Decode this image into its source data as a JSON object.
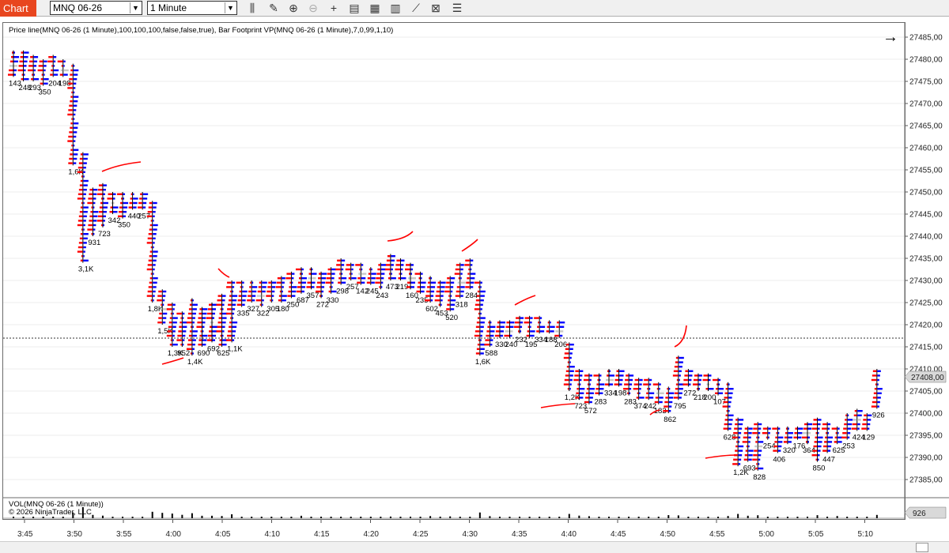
{
  "toolbar": {
    "tab_label": "Chart",
    "instrument": "MNQ 06-26",
    "interval": "1 Minute",
    "icons": [
      "bar-type-icon",
      "drawing-tool-icon",
      "zoom-in-icon",
      "zoom-out-icon",
      "crosshair-icon",
      "data-box-icon",
      "chart-trader-icon",
      "chart-style-icon",
      "indicators-icon",
      "strategies-icon",
      "properties-icon"
    ]
  },
  "chart": {
    "indicator_label": "Price line(MNQ 06-26 (1 Minute),100,100,100,false,false,true), Bar Footprint VP(MNQ 06-26 (1 Minute),7,0,99,1,10)",
    "vol_label": "VOL(MNQ 06-26 (1 Minute))",
    "copyright": "© 2026 NinjaTrader, LLC",
    "current_price": "27408,00",
    "current_volume": "926",
    "price_axis": {
      "ticks": [
        "27485,00",
        "27480,00",
        "27475,00",
        "27470,00",
        "27465,00",
        "27460,00",
        "27455,00",
        "27450,00",
        "27445,00",
        "27440,00",
        "27435,00",
        "27430,00",
        "27425,00",
        "27420,00",
        "27415,00",
        "27410,00",
        "27405,00",
        "27400,00",
        "27395,00",
        "27390,00",
        "27385,00"
      ]
    },
    "time_axis": {
      "ticks": [
        "3:45",
        "3:50",
        "3:55",
        "4:00",
        "4:05",
        "4:10",
        "4:15",
        "4:20",
        "4:25",
        "4:30",
        "4:35",
        "4:40",
        "4:45",
        "4:50",
        "4:55",
        "5:00",
        "5:05",
        "5:10"
      ]
    },
    "colors": {
      "bid": "#ff0000",
      "ask": "#0000ff",
      "poc": "#c8c8c8",
      "annotation": "#ff0000",
      "price_tag": "#d9d9d9"
    }
  },
  "chart_data": {
    "type": "bar",
    "title": "",
    "ylim": [
      27383,
      27487
    ],
    "bars": [
      {
        "t": 0,
        "high": 27482,
        "low": 27476,
        "label": "143"
      },
      {
        "t": 1,
        "high": 27482,
        "low": 27475,
        "label": "248"
      },
      {
        "t": 2,
        "high": 27481,
        "low": 27475,
        "label": "293"
      },
      {
        "t": 3,
        "high": 27480,
        "low": 27474,
        "label": "350"
      },
      {
        "t": 4,
        "high": 27481,
        "low": 27476,
        "label": "204"
      },
      {
        "t": 5,
        "high": 27480,
        "low": 27476,
        "label": "198"
      },
      {
        "t": 6,
        "high": 27479,
        "low": 27456,
        "label": "1,6K"
      },
      {
        "t": 7,
        "high": 27459,
        "low": 27434,
        "label": "3,1K"
      },
      {
        "t": 8,
        "high": 27451,
        "low": 27440,
        "label": "931"
      },
      {
        "t": 9,
        "high": 27452,
        "low": 27442,
        "label": "723"
      },
      {
        "t": 10,
        "high": 27450,
        "low": 27445,
        "label": "342"
      },
      {
        "t": 11,
        "high": 27450,
        "low": 27444,
        "label": "350"
      },
      {
        "t": 12,
        "high": 27450,
        "low": 27446,
        "label": "440"
      },
      {
        "t": 13,
        "high": 27450,
        "low": 27446,
        "label": "257"
      },
      {
        "t": 14,
        "high": 27448,
        "low": 27425,
        "label": "1,8K"
      },
      {
        "t": 15,
        "high": 27428,
        "low": 27420,
        "label": "1,5K"
      },
      {
        "t": 16,
        "high": 27425,
        "low": 27415,
        "label": "1,3K"
      },
      {
        "t": 17,
        "high": 27423,
        "low": 27415,
        "label": "952"
      },
      {
        "t": 18,
        "high": 27426,
        "low": 27413,
        "label": "1,4K"
      },
      {
        "t": 19,
        "high": 27424,
        "low": 27415,
        "label": "690"
      },
      {
        "t": 20,
        "high": 27425,
        "low": 27416,
        "label": "692"
      },
      {
        "t": 21,
        "high": 27427,
        "low": 27415,
        "label": "625"
      },
      {
        "t": 22,
        "high": 27430,
        "low": 27416,
        "label": "1,1K"
      },
      {
        "t": 23,
        "high": 27430,
        "low": 27424,
        "label": "335"
      },
      {
        "t": 24,
        "high": 27430,
        "low": 27425,
        "label": "327"
      },
      {
        "t": 25,
        "high": 27430,
        "low": 27424,
        "label": "322"
      },
      {
        "t": 26,
        "high": 27430,
        "low": 27425,
        "label": "305"
      },
      {
        "t": 27,
        "high": 27431,
        "low": 27425,
        "label": "180"
      },
      {
        "t": 28,
        "high": 27432,
        "low": 27426,
        "label": "250"
      },
      {
        "t": 29,
        "high": 27433,
        "low": 27427,
        "label": "687"
      },
      {
        "t": 30,
        "high": 27433,
        "low": 27428,
        "label": "357"
      },
      {
        "t": 31,
        "high": 27432,
        "low": 27426,
        "label": "272"
      },
      {
        "t": 32,
        "high": 27433,
        "low": 27427,
        "label": "330"
      },
      {
        "t": 33,
        "high": 27435,
        "low": 27429,
        "label": "298"
      },
      {
        "t": 34,
        "high": 27434,
        "low": 27430,
        "label": "257"
      },
      {
        "t": 35,
        "high": 27434,
        "low": 27429,
        "label": "142"
      },
      {
        "t": 36,
        "high": 27433,
        "low": 27429,
        "label": "245"
      },
      {
        "t": 37,
        "high": 27434,
        "low": 27428,
        "label": "243"
      },
      {
        "t": 38,
        "high": 27436,
        "low": 27430,
        "label": "473"
      },
      {
        "t": 39,
        "high": 27435,
        "low": 27430,
        "label": "219"
      },
      {
        "t": 40,
        "high": 27434,
        "low": 27428,
        "label": "160"
      },
      {
        "t": 41,
        "high": 27432,
        "low": 27427,
        "label": "235"
      },
      {
        "t": 42,
        "high": 27431,
        "low": 27425,
        "label": "602"
      },
      {
        "t": 43,
        "high": 27430,
        "low": 27424,
        "label": "453"
      },
      {
        "t": 44,
        "high": 27431,
        "low": 27423,
        "label": "520"
      },
      {
        "t": 45,
        "high": 27434,
        "low": 27426,
        "label": "318"
      },
      {
        "t": 46,
        "high": 27435,
        "low": 27428,
        "label": "284"
      },
      {
        "t": 47,
        "high": 27430,
        "low": 27413,
        "label": "1,6K"
      },
      {
        "t": 48,
        "high": 27421,
        "low": 27415,
        "label": "588"
      },
      {
        "t": 49,
        "high": 27421,
        "low": 27417,
        "label": "330"
      },
      {
        "t": 50,
        "high": 27421,
        "low": 27417,
        "label": "240"
      },
      {
        "t": 51,
        "high": 27422,
        "low": 27418,
        "label": "232"
      },
      {
        "t": 52,
        "high": 27422,
        "low": 27417,
        "label": "195"
      },
      {
        "t": 53,
        "high": 27422,
        "low": 27418,
        "label": "334"
      },
      {
        "t": 54,
        "high": 27421,
        "low": 27418,
        "label": "188"
      },
      {
        "t": 55,
        "high": 27421,
        "low": 27417,
        "label": "206"
      },
      {
        "t": 56,
        "high": 27416,
        "low": 27405,
        "label": "1,2K"
      },
      {
        "t": 57,
        "high": 27410,
        "low": 27403,
        "label": "723"
      },
      {
        "t": 58,
        "high": 27409,
        "low": 27402,
        "label": "572"
      },
      {
        "t": 59,
        "high": 27409,
        "low": 27404,
        "label": "283"
      },
      {
        "t": 60,
        "high": 27410,
        "low": 27406,
        "label": "334"
      },
      {
        "t": 61,
        "high": 27410,
        "low": 27406,
        "label": "198"
      },
      {
        "t": 62,
        "high": 27409,
        "low": 27404,
        "label": "283"
      },
      {
        "t": 63,
        "high": 27408,
        "low": 27403,
        "label": "374"
      },
      {
        "t": 64,
        "high": 27408,
        "low": 27403,
        "label": "242"
      },
      {
        "t": 65,
        "high": 27407,
        "low": 27402,
        "label": "183"
      },
      {
        "t": 66,
        "high": 27406,
        "low": 27400,
        "label": "862"
      },
      {
        "t": 67,
        "high": 27413,
        "low": 27403,
        "label": "795"
      },
      {
        "t": 68,
        "high": 27410,
        "low": 27406,
        "label": "272"
      },
      {
        "t": 69,
        "high": 27409,
        "low": 27405,
        "label": "218"
      },
      {
        "t": 70,
        "high": 27409,
        "low": 27405,
        "label": "200"
      },
      {
        "t": 71,
        "high": 27408,
        "low": 27404,
        "label": "107"
      },
      {
        "t": 72,
        "high": 27407,
        "low": 27396,
        "label": "628"
      },
      {
        "t": 73,
        "high": 27399,
        "low": 27388,
        "label": "1,2K"
      },
      {
        "t": 74,
        "high": 27397,
        "low": 27389,
        "label": "693"
      },
      {
        "t": 75,
        "high": 27398,
        "low": 27387,
        "label": "828"
      },
      {
        "t": 76,
        "high": 27397,
        "low": 27394,
        "label": "254"
      },
      {
        "t": 77,
        "high": 27397,
        "low": 27391,
        "label": "406"
      },
      {
        "t": 78,
        "high": 27397,
        "low": 27393,
        "label": "320"
      },
      {
        "t": 79,
        "high": 27397,
        "low": 27394,
        "label": "176"
      },
      {
        "t": 80,
        "high": 27398,
        "low": 27393,
        "label": "364"
      },
      {
        "t": 81,
        "high": 27399,
        "low": 27389,
        "label": "850"
      },
      {
        "t": 82,
        "high": 27398,
        "low": 27391,
        "label": "447"
      },
      {
        "t": 83,
        "high": 27397,
        "low": 27393,
        "label": "625"
      },
      {
        "t": 84,
        "high": 27400,
        "low": 27394,
        "label": "253"
      },
      {
        "t": 85,
        "high": 27401,
        "low": 27396,
        "label": "424"
      },
      {
        "t": 86,
        "high": 27400,
        "low": 27396,
        "label": "129"
      },
      {
        "t": 87,
        "high": 27410,
        "low": 27401,
        "label": "926"
      }
    ]
  }
}
